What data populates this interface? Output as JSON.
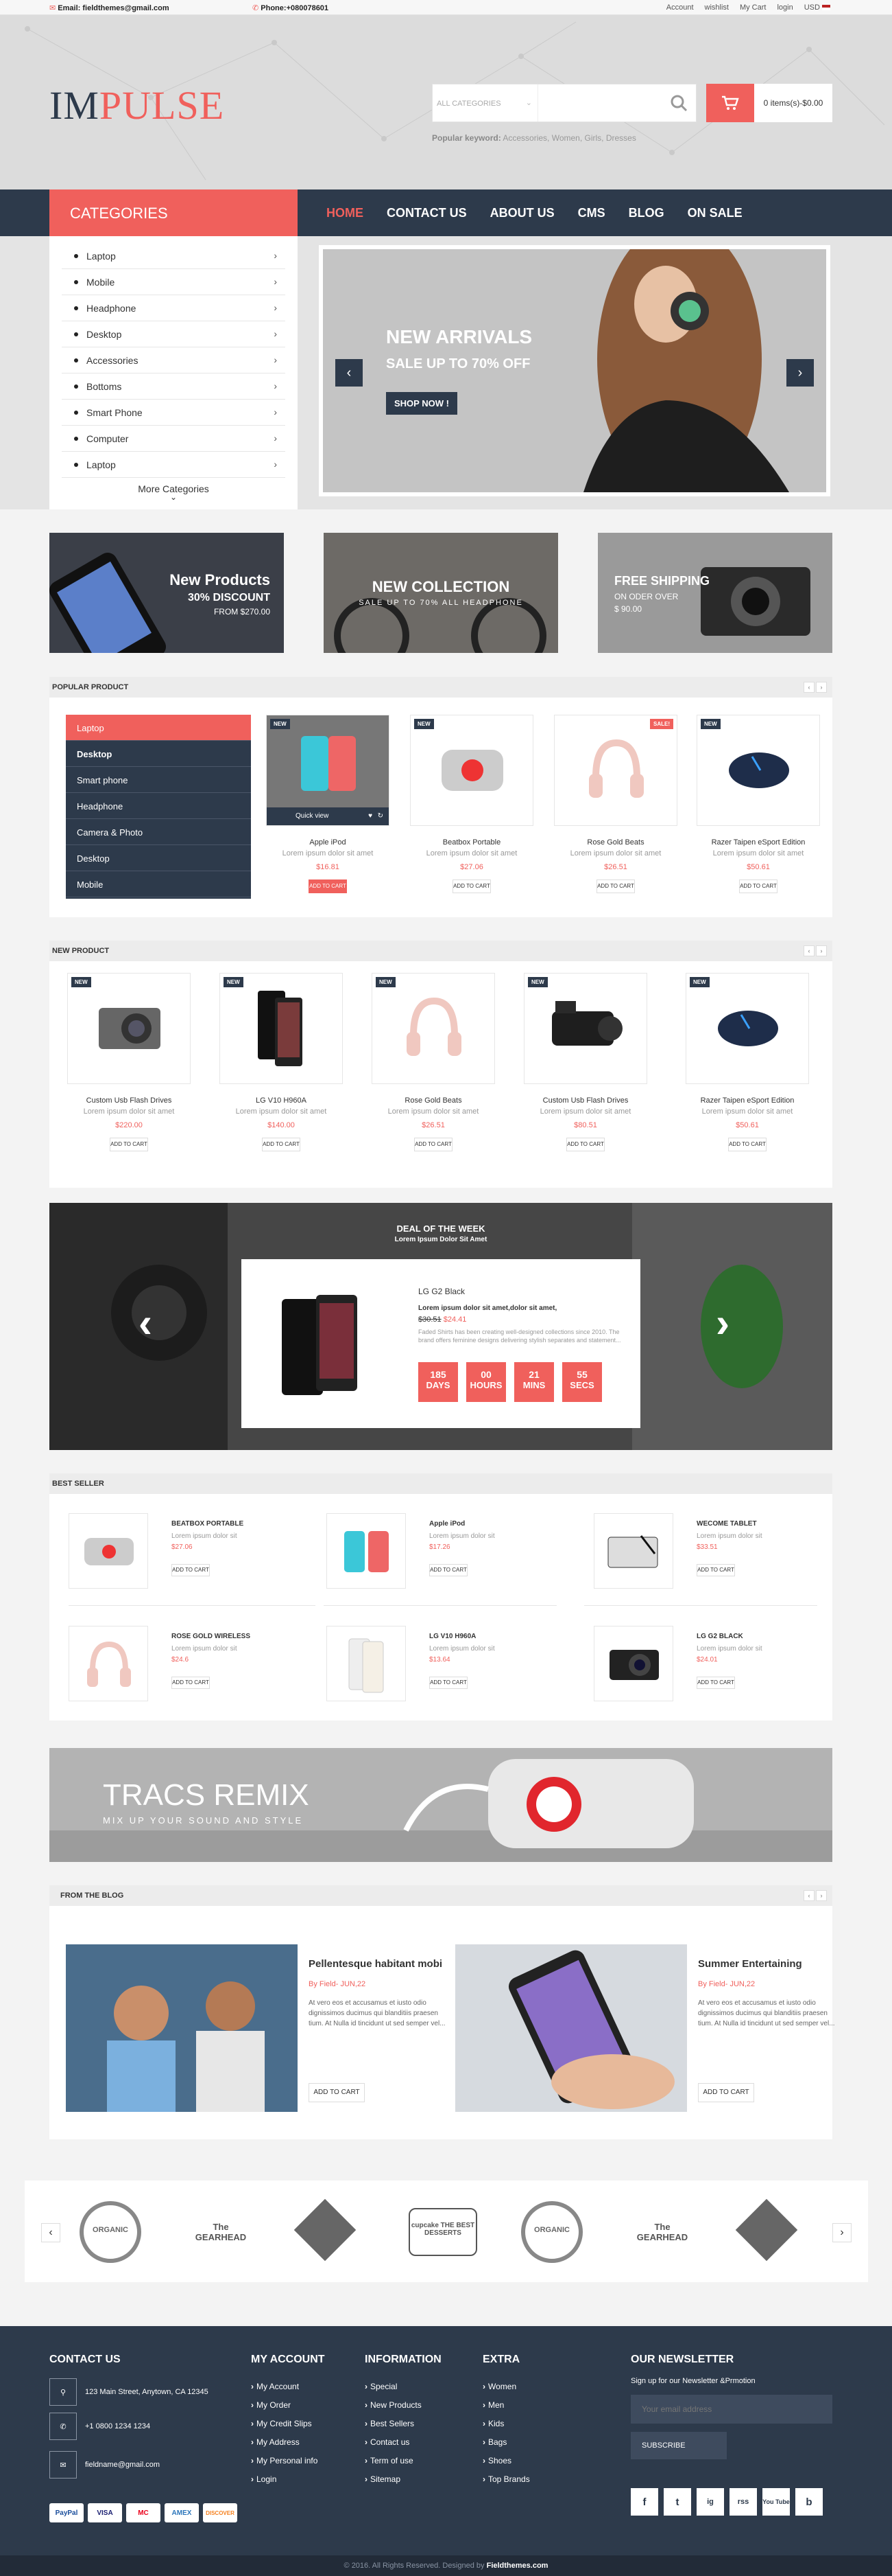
{
  "topbar": {
    "email_label": "Email:",
    "email": "fieldthemes@gmail.com",
    "phone_label": "Phone:",
    "phone": "+080078601",
    "links": [
      "Account",
      "wishlist",
      "My Cart",
      "login"
    ],
    "currency": "USD"
  },
  "header": {
    "logo_a": "IM",
    "logo_b": "PULSE",
    "search_category": "ALL CATEGORIES",
    "search_placeholder": "",
    "cart_text": "0 items(s)-$0.00",
    "popular_label": "Popular keyword:",
    "popular_keywords": "Accessories, Women, Girls, Dresses"
  },
  "nav": {
    "categories_label": "CATEGORIES",
    "menu": [
      "HOME",
      "CONTACT US",
      "ABOUT US",
      "CMS",
      "BLOG",
      "ON SALE"
    ]
  },
  "categories": [
    "Laptop",
    "Mobile",
    "Headphone",
    "Desktop",
    "Accessories",
    "Bottoms",
    "Smart Phone",
    "Computer",
    "Laptop"
  ],
  "more_categories": "More Categories",
  "hero": {
    "title": "NEW ARRIVALS",
    "subtitle": "SALE UP TO 70% OFF",
    "button": "SHOP NOW !"
  },
  "banners": [
    {
      "title": "New Products",
      "line2": "30% DISCOUNT",
      "line3": "FROM $270.00"
    },
    {
      "title": "NEW COLLECTION",
      "line2": "SALE UP TO 70% ALL HEADPHONE"
    },
    {
      "title": "FREE SHIPPING",
      "line2": "ON ODER OVER",
      "line3": "$ 90.00"
    }
  ],
  "popular": {
    "title": "POPULAR PRODUCT",
    "categories": [
      "Laptop",
      "Desktop",
      "Smart phone",
      "Headphone",
      "Camera & Photo",
      "Desktop",
      "Mobile"
    ],
    "products": [
      {
        "name": "Apple iPod",
        "desc": "Lorem ipsum dolor sit amet",
        "price": "$16.81",
        "badge": "NEW",
        "atc": "ADD TO CART",
        "quickview": "Quick view"
      },
      {
        "name": "Beatbox Portable",
        "desc": "Lorem ipsum dolor sit amet",
        "price": "$27.06",
        "badge": "NEW",
        "atc": "ADD TO CART"
      },
      {
        "name": "Rose Gold Beats",
        "desc": "Lorem ipsum dolor sit amet",
        "price": "$26.51",
        "badge": "SALE!",
        "atc": "ADD TO CART"
      },
      {
        "name": "Razer Taipen eSport Edition",
        "desc": "Lorem ipsum dolor sit amet",
        "price": "$50.61",
        "badge": "NEW",
        "atc": "ADD TO CART"
      }
    ]
  },
  "newproduct": {
    "title": "NEW PRODUCT",
    "products": [
      {
        "name": "Custom Usb Flash Drives",
        "desc": "Lorem ipsum dolor sit amet",
        "price": "$220.00",
        "badge": "NEW",
        "atc": "ADD TO CART"
      },
      {
        "name": "LG V10 H960A",
        "desc": "Lorem ipsum dolor sit amet",
        "price": "$140.00",
        "badge": "NEW",
        "atc": "ADD TO CART"
      },
      {
        "name": "Rose Gold Beats",
        "desc": "Lorem ipsum dolor sit amet",
        "price": "$26.51",
        "badge": "NEW",
        "atc": "ADD TO CART"
      },
      {
        "name": "Custom Usb Flash Drives",
        "desc": "Lorem ipsum dolor sit amet",
        "price": "$80.51",
        "badge": "NEW",
        "atc": "ADD TO CART"
      },
      {
        "name": "Razer Taipen eSport Edition",
        "desc": "Lorem ipsum dolor sit amet",
        "price": "$50.61",
        "badge": "NEW",
        "atc": "ADD TO CART"
      }
    ]
  },
  "deal": {
    "title": "DEAL OF THE WEEK",
    "subtitle": "Lorem Ipsum Dolor Sit Amet",
    "product": "LG G2 Black",
    "short": "Lorem ipsum dolor sit amet,dolor sit amet,",
    "old_price": "$30.51",
    "price": "$24.41",
    "text": "Faded Shirts has been creating well-designed collections since 2010. The brand offers feminine designs delivering stylish separates and statement...",
    "timer": [
      {
        "value": "185",
        "unit": "DAYS"
      },
      {
        "value": "00",
        "unit": "HOURS"
      },
      {
        "value": "21",
        "unit": "MINS"
      },
      {
        "value": "55",
        "unit": "SECS"
      }
    ]
  },
  "bestseller": {
    "title": "BEST SELLER",
    "items": [
      {
        "name": "BEATBOX PORTABLE",
        "desc": "Lorem ipsum dolor sit",
        "price": "$27.06",
        "atc": "ADD TO CART"
      },
      {
        "name": "Apple iPod",
        "desc": "Lorem ipsum dolor sit",
        "price": "$17.26",
        "atc": "ADD TO CART"
      },
      {
        "name": "WECOME TABLET",
        "desc": "Lorem ipsum dolor sit",
        "price": "$33.51",
        "atc": "ADD TO CART"
      },
      {
        "name": "ROSE GOLD WIRELESS",
        "desc": "Lorem ipsum dolor sit",
        "price": "$24.6",
        "atc": "ADD TO CART"
      },
      {
        "name": "LG V10 H960A",
        "desc": "Lorem ipsum dolor sit",
        "price": "$13.64",
        "atc": "ADD TO CART"
      },
      {
        "name": "LG G2 BLACK",
        "desc": "Lorem ipsum dolor sit",
        "price": "$24.01",
        "atc": "ADD TO CART"
      }
    ]
  },
  "tracs": {
    "title": "TRACS REMIX",
    "subtitle": "MIX UP YOUR SOUND AND STYLE"
  },
  "blog": {
    "title": "FROM THE BLOG",
    "posts": [
      {
        "title": "Pellentesque habitant mobi",
        "by": "By Field- JUN,22",
        "text": "At vero eos et accusamus et iusto odio dignissimos ducimus qui blanditiis praesen tium. At Nulla id tincidunt ut sed semper vel...",
        "button": "ADD TO CART"
      },
      {
        "title": "Summer Entertaining",
        "by": "By Field- JUN,22",
        "text": "At vero eos et accusamus et iusto odio dignissimos ducimus qui blanditiis praesen tium. At Nulla id tincidunt ut sed semper vel...",
        "button": "ADD TO CART"
      }
    ]
  },
  "brands": [
    "ORGANIC",
    "The GEARHEAD",
    "",
    "cupcake THE BEST DESSERTS",
    "ORGANIC",
    "The GEARHEAD",
    ""
  ],
  "footer": {
    "contact_title": "CONTACT US",
    "address": "123 Main Street, Anytown, CA 12345",
    "phone": "+1 0800 1234 1234",
    "email": "fieldname@gmail.com",
    "account_title": "MY ACCOUNT",
    "account_links": [
      "My Account",
      "My Order",
      "My Credit Slips",
      "My Address",
      "My Personal info",
      "Login"
    ],
    "info_title": "INFORMATION",
    "info_links": [
      "Special",
      "New Products",
      "Best Sellers",
      "Contact us",
      "Term of use",
      "Sitemap"
    ],
    "extra_title": "EXTRA",
    "extra_links": [
      "Women",
      "Men",
      "Kids",
      "Bags",
      "Shoes",
      "Top Brands"
    ],
    "newsletter_title": "OUR NEWSLETTER",
    "newsletter_text": "Sign up for our Newsletter &Prmotion",
    "newsletter_placeholder": "Your email address",
    "subscribe": "SUBSCRIBE",
    "payments": [
      "PayPal",
      "VISA",
      "MC",
      "AMEX",
      "DISCOVER"
    ],
    "social": [
      "f",
      "t",
      "ig",
      "rss",
      "You Tube",
      "b"
    ],
    "copyright_a": "© 2016. All Rights Reserved. Designed by",
    "copyright_b": "Fieldthemes.com"
  },
  "colors": {
    "accent": "#f0605c",
    "navy": "#2d3a4b"
  }
}
